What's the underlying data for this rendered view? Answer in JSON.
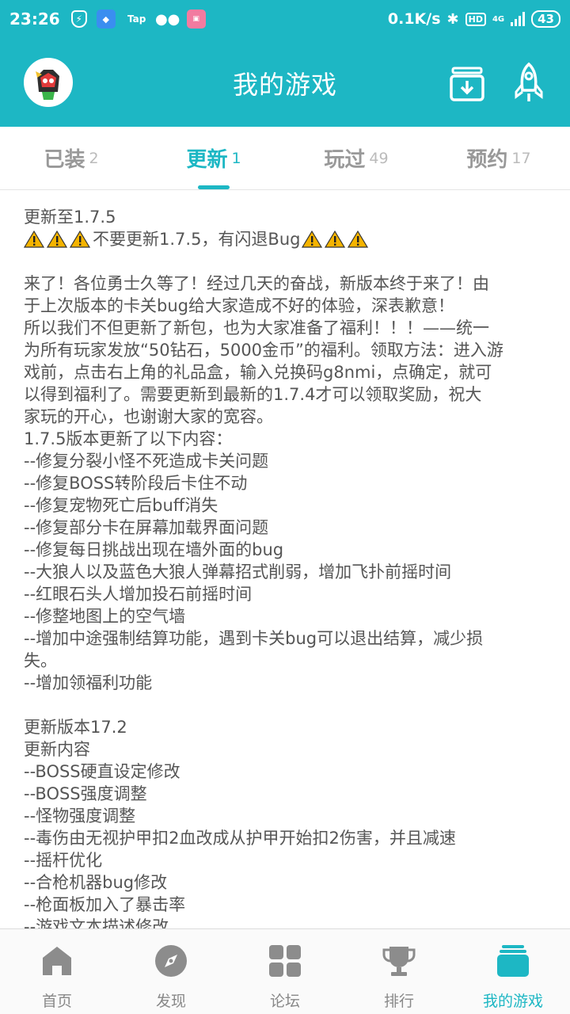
{
  "status_bar": {
    "time": "23:26",
    "tap_label": "Tap",
    "speed": "0.1K/s",
    "hd": "HD",
    "network": "4G",
    "battery": "43"
  },
  "header": {
    "title": "我的游戏"
  },
  "tabs": [
    {
      "label": "已装",
      "count": "2",
      "active": false
    },
    {
      "label": "更新",
      "count": "1",
      "active": true
    },
    {
      "label": "玩过",
      "count": "49",
      "active": false
    },
    {
      "label": "预约",
      "count": "17",
      "active": false
    }
  ],
  "content": {
    "update_to": "更新至1.7.5",
    "warning_text": "不要更新1.7.5，有闪退Bug",
    "lines": [
      "",
      "来了！各位勇士久等了！经过几天的奋战，新版本终于来了！由",
      "于上次版本的卡关bug给大家造成不好的体验，深表歉意！",
      "所以我们不但更新了新包，也为大家准备了福利！！！——统一",
      "为所有玩家发放“50钻石，5000金币”的福利。领取方法：进入游",
      "戏前，点击右上角的礼品盒，输入兑换码g8nmi，点确定，就可",
      "以得到福利了。需要更新到最新的1.7.4才可以领取奖励，祝大",
      "家玩的开心，也谢谢大家的宽容。",
      "1.7.5版本更新了以下内容：",
      "--修复分裂小怪不死造成卡关问题",
      "--修复BOSS转阶段后卡住不动",
      "--修复宠物死亡后buff消失",
      "--修复部分卡在屏幕加载界面问题",
      "--修复每日挑战出现在墙外面的bug",
      "--大狼人以及蓝色大狼人弹幕招式削弱，增加飞扑前摇时间",
      "--红眼石头人增加投石前摇时间",
      "--修整地图上的空气墙",
      "--增加中途强制结算功能，遇到卡关bug可以退出结算，减少损",
      "失。",
      "--增加领福利功能",
      "",
      "更新版本17.2",
      "更新内容",
      "--BOSS硬直设定修改",
      "--BOSS强度调整",
      "--怪物强度调整",
      "--毒伤由无视护甲扣2血改成从护甲开始扣2伤害，并且减速",
      "--摇杆优化",
      "--合枪机器bug修改",
      "--枪面板加入了暴击率",
      "--游戏文本描述修改"
    ]
  },
  "bottom_nav": [
    {
      "label": "首页",
      "icon": "home-icon",
      "active": false
    },
    {
      "label": "发现",
      "icon": "compass-icon",
      "active": false
    },
    {
      "label": "论坛",
      "icon": "grid-icon",
      "active": false
    },
    {
      "label": "排行",
      "icon": "trophy-icon",
      "active": false
    },
    {
      "label": "我的游戏",
      "icon": "my-games-icon",
      "active": true
    }
  ],
  "colors": {
    "accent": "#1db7c4",
    "warning": "#f5b400"
  }
}
